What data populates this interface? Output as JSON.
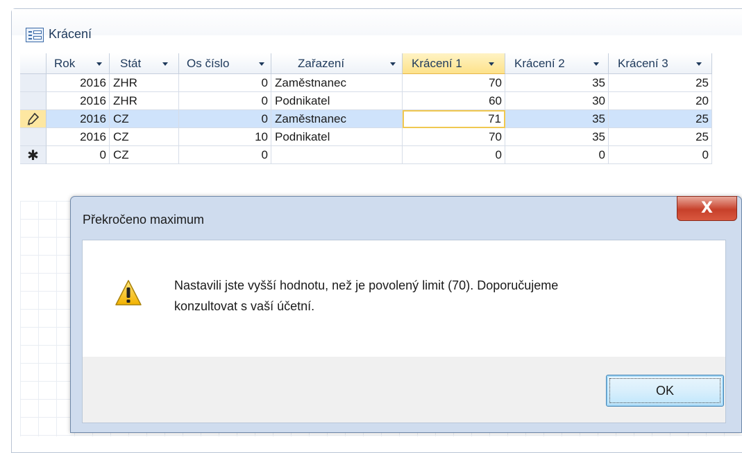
{
  "window": {
    "title": "Krácení",
    "icon": "datasheet-icon"
  },
  "table": {
    "columns": [
      {
        "key": "rok",
        "label": "Rok"
      },
      {
        "key": "stat",
        "label": "Stát"
      },
      {
        "key": "os_cislo",
        "label": "Os číslo"
      },
      {
        "key": "zarazeni",
        "label": "Zařazení"
      },
      {
        "key": "kraceni1",
        "label": "Krácení 1"
      },
      {
        "key": "kraceni2",
        "label": "Krácení 2"
      },
      {
        "key": "kraceni3",
        "label": "Krácení 3"
      }
    ],
    "rows": [
      {
        "selector": "",
        "cells": [
          "2016",
          "ZHR",
          "0",
          "Zaměstnanec",
          "70",
          "35",
          "25"
        ]
      },
      {
        "selector": "",
        "cells": [
          "2016",
          "ZHR",
          "0",
          "Podnikatel",
          "60",
          "30",
          "20"
        ]
      },
      {
        "selector": "pencil-icon",
        "cells": [
          "2016",
          "CZ",
          "0",
          "Zaměstnanec",
          "71",
          "35",
          "25"
        ]
      },
      {
        "selector": "",
        "cells": [
          "2016",
          "CZ",
          "10",
          "Podnikatel",
          "70",
          "35",
          "25"
        ]
      },
      {
        "selector": "new-record-icon",
        "cells": [
          "0",
          "CZ",
          "0",
          "",
          "0",
          "0",
          "0"
        ]
      }
    ],
    "active_column": "Krácení 1"
  },
  "dialog": {
    "title": "Překročeno maximum",
    "close_label": "X",
    "icon": "warning-icon",
    "message_line1": "Nastavili jste vyšší hodnotu, než je povolený limit (70). Doporučujeme",
    "message_line2": "konzultovat s vaší účetní.",
    "ok_label": "OK"
  },
  "colors": {
    "current_row": "#cfe3fb",
    "active_header": "#fde28a",
    "dialog_frame": "#cfdcee",
    "close_button": "#c7402a"
  }
}
